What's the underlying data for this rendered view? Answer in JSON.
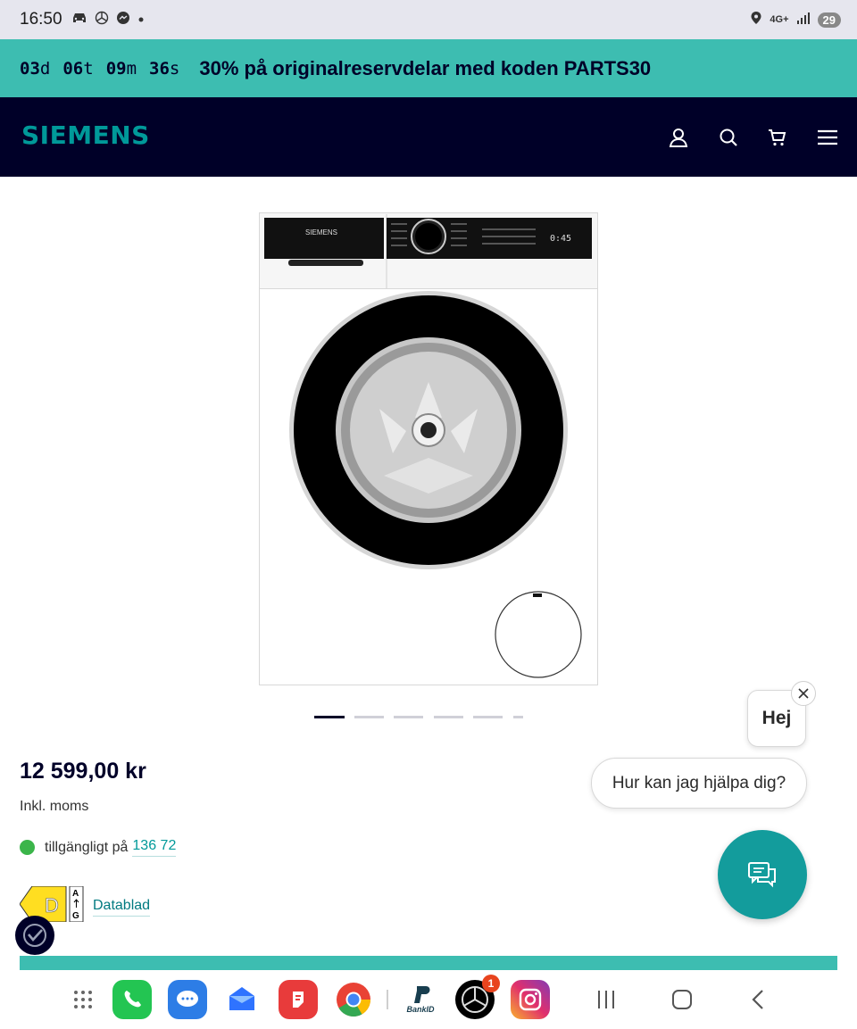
{
  "status_bar": {
    "time": "16:50",
    "network": "4G+",
    "battery": "29"
  },
  "promo": {
    "countdown": [
      {
        "value": "03",
        "unit": "d"
      },
      {
        "value": "06",
        "unit": "t"
      },
      {
        "value": "09",
        "unit": "m"
      },
      {
        "value": "36",
        "unit": "s"
      }
    ],
    "text": "30% på originalreservdelar med koden PARTS30"
  },
  "header": {
    "logo": "SIEMENS",
    "icons": [
      "account-icon",
      "search-icon",
      "cart-icon",
      "menu-icon"
    ]
  },
  "washer_panel": {
    "brand": "SIEMENS",
    "display": "0:45"
  },
  "gallery": {
    "total": 6,
    "active_index": 0
  },
  "product": {
    "price": "12 599,00 kr",
    "vat_note": "Inkl. moms",
    "availability_text": "tillgängligt på",
    "availability_link": "136 72",
    "energy_class": "D",
    "energy_scale_top": "A",
    "energy_scale_bottom": "G",
    "datasheet_label": "Datablad"
  },
  "chat": {
    "greeting": "Hej",
    "prompt": "Hur kan jag hjälpa dig?"
  },
  "dock": {
    "apps": [
      "app-drawer-icon",
      "phone-app-icon",
      "messages-app-icon",
      "blue-app-icon",
      "red-app-icon",
      "chrome-app-icon",
      "bankid-app-icon",
      "mercedes-app-icon",
      "instagram-app-icon"
    ],
    "mercedes_badge": "1",
    "bankid_label": "BankID"
  },
  "colors": {
    "promo_bg": "#3dbdb1",
    "header_bg": "#000028",
    "brand_teal": "#009999",
    "chat_button": "#139c9c",
    "available_green": "#3bb54a"
  }
}
